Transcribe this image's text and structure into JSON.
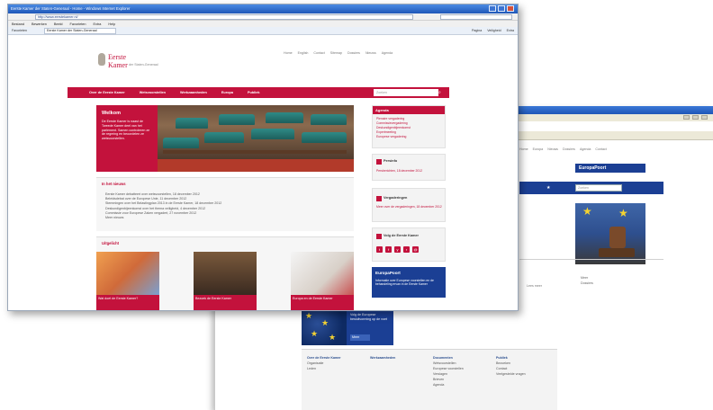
{
  "back_window": {
    "crumbs": [
      "Home",
      "Europa",
      "Nieuws",
      "Dossiers",
      "Agenda",
      "Contact"
    ],
    "logo": "EuropaPoort",
    "search_placeholder": "Zoeken",
    "side_small": [
      "Meer",
      "Dossiers"
    ],
    "right_text": "Lees meer",
    "promo_text": "Volg de Europese besluitvorming op de voet",
    "promo_button": "Meer",
    "footer": {
      "col1_head": "Over de Eerste Kamer",
      "col1_items": [
        "Organisatie",
        "Leden"
      ],
      "col2_head": "Werkzaamheden",
      "col3_head": "Documenten",
      "col3_items": [
        "Wetsvoorstellen",
        "Europese voorstellen",
        "Verslagen",
        "Brieven",
        "Agenda"
      ],
      "col4_head": "Publiek",
      "col4_items": [
        "Bezoeken",
        "Contact",
        "Veelgestelde vragen"
      ]
    }
  },
  "front_window": {
    "title": "Eerste Kamer der Staten-Generaal - Home - Windows Internet Explorer",
    "address": "http://www.eerstekamer.nl/",
    "menu": [
      "Bestand",
      "Bewerken",
      "Beeld",
      "Favorieten",
      "Extra",
      "Help"
    ],
    "fav_label": "Favorieten",
    "fav_tab": "Eerste Kamer der Staten-Generaal",
    "commands": [
      "Pagina",
      "Veiligheid",
      "Extra"
    ],
    "logo_line1": "Eerste",
    "logo_line2": "Kamer",
    "logo_sub": "der Staten-Generaal",
    "toplinks": [
      "Home",
      "English",
      "Contact",
      "Sitemap",
      "Dossiers",
      "Nieuws",
      "Agenda"
    ],
    "nav": [
      "Over de Eerste Kamer",
      "Wetsvoorstellen",
      "Werkzaamheden",
      "Europa",
      "Publiek"
    ],
    "search_placeholder": "Zoeken",
    "hero_title": "Welkom",
    "hero_text": "De Eerste Kamer is naast de Tweede Kamer deel van het parlement. Samen controleren ze de regering en beoordelen ze wetsvoorstellen.",
    "news_title": "In het nieuws",
    "news_items": [
      "Eerste Kamer debatteert over wetsvoorstellen, 18 december 2012",
      "Beleidsdebat over de Europese Unie, 11 december 2012",
      "Stemmingen over het Belastingplan 2013 in de Eerste Kamer, 18 december 2012",
      "Deskundigenbijeenkomst over het thema veiligheid, 4 december 2012",
      "Commissie voor Europese Zaken vergadert, 27 november 2012",
      "Meer nieuws"
    ],
    "uitgelicht_title": "Uitgelicht",
    "cards": [
      "Wat doet de Eerste Kamer?",
      "Bezoek de Eerste Kamer",
      "Europa en de Eerste Kamer"
    ],
    "agenda_head": "Agenda",
    "agenda_items": [
      "Plenaire vergadering",
      "Commissievergadering",
      "Deskundigenbijeenkomst",
      "Expertmeeting",
      "Europese vergadering"
    ],
    "side1_title": "Persinfo",
    "side1_link": "Persberichten, 18 december 2012",
    "side2_title": "Vergaderingen",
    "side2_link": "Meer over de vergaderingen, 18 december 2012",
    "side3_title": "Volg de Eerste Kamer",
    "social": [
      "t",
      "f",
      "y",
      "r",
      "@"
    ],
    "europa_title": "EuropaPoort",
    "europa_text": "Informatie over Europese voorstellen en de behandeling ervan in de Eerste Kamer"
  },
  "colors": {
    "ek_red": "#c3123c",
    "europa_blue": "#1b3f94"
  }
}
